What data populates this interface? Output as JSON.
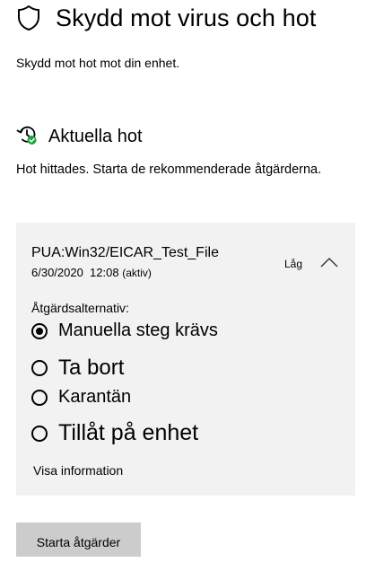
{
  "header": {
    "title": "Skydd mot virus och hot",
    "icon": "shield-icon",
    "subtitle": "Skydd mot hot mot din enhet."
  },
  "current_threats": {
    "title": "Aktuella hot",
    "icon": "history-check-icon",
    "icon_accent": "#1aa33a",
    "description": "Hot hittades. Starta de rekommenderade åtgärderna."
  },
  "threat": {
    "name": "PUA:Win32/EICAR_Test_File",
    "date": "6/30/2020  12:08",
    "status": "(aktiv)",
    "severity": "Låg",
    "expanded": true,
    "options_label": "Åtgärdsalternativ:",
    "options": [
      {
        "label": "Manuella steg krävs",
        "selected": true
      },
      {
        "label": "Ta bort",
        "selected": false
      },
      {
        "label": "Karantän",
        "selected": false
      },
      {
        "label": "Tillåt på enhet",
        "selected": false
      }
    ],
    "details_link": "Visa information"
  },
  "actions": {
    "start_label": "Starta åtgärder"
  },
  "colors": {
    "card_background": "#f2f2f2",
    "button_background": "#cccccc"
  }
}
